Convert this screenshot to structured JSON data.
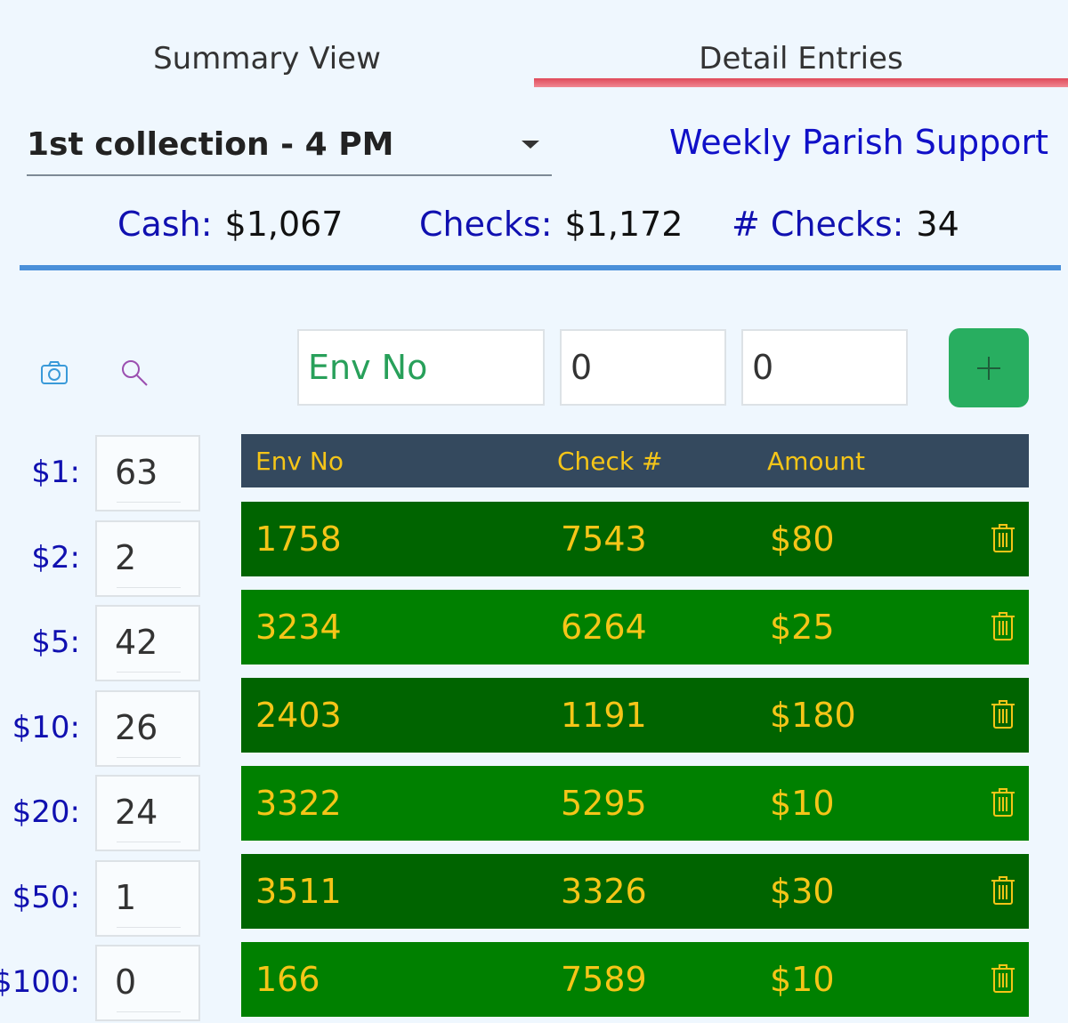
{
  "tabs": [
    {
      "label": "Summary View",
      "active": false
    },
    {
      "label": "Detail Entries",
      "active": true
    }
  ],
  "collection": {
    "selected": "1st collection - 4 PM"
  },
  "fund": "Weekly Parish Support",
  "totals": {
    "cash_label": "Cash:",
    "cash": "$1,067",
    "checks_label": "Checks:",
    "checks": "$1,172",
    "num_checks_label": "# Checks:",
    "num_checks": "34"
  },
  "entry": {
    "env_placeholder": "Env No",
    "check_value": "0",
    "amount_value": "0",
    "add_icon": "plus-icon"
  },
  "icons": {
    "camera": "camera-icon",
    "search": "search-icon"
  },
  "denominations": [
    {
      "label": "$1:",
      "count": "63"
    },
    {
      "label": "$2:",
      "count": "2"
    },
    {
      "label": "$5:",
      "count": "42"
    },
    {
      "label": "$10:",
      "count": "26"
    },
    {
      "label": "$20:",
      "count": "24"
    },
    {
      "label": "$50:",
      "count": "1"
    },
    {
      "label": "$100:",
      "count": "0"
    }
  ],
  "table": {
    "headers": {
      "env": "Env No",
      "check": "Check #",
      "amount": "Amount"
    },
    "rows": [
      {
        "env": "1758",
        "check": "7543",
        "amount": "$80"
      },
      {
        "env": "3234",
        "check": "6264",
        "amount": "$25"
      },
      {
        "env": "2403",
        "check": "1191",
        "amount": "$180"
      },
      {
        "env": "3322",
        "check": "5295",
        "amount": "$10"
      },
      {
        "env": "3511",
        "check": "3326",
        "amount": "$30"
      },
      {
        "env": "166",
        "check": "7589",
        "amount": "$10"
      }
    ]
  },
  "colors": {
    "accent_blue": "#1010c8",
    "tab_indicator": "#e04a5a",
    "add_button": "#28ae60",
    "header_bg": "#34495e",
    "row_dark": "#006400",
    "row_light": "#008000",
    "text_gold": "#f5c518"
  }
}
